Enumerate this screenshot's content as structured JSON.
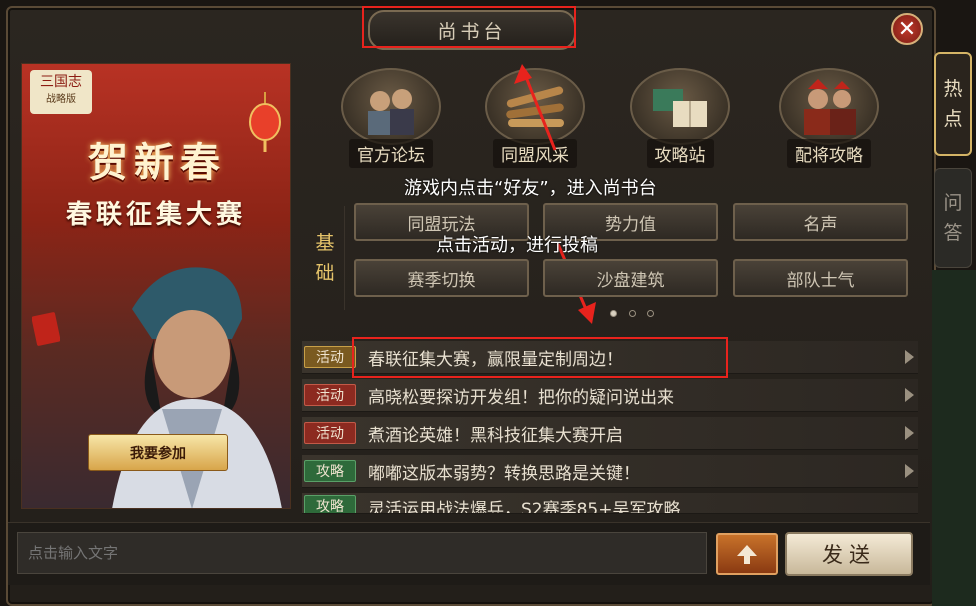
{
  "window": {
    "title": "尚书台",
    "close_glyph": "✕"
  },
  "side_tabs": [
    {
      "label_1": "热",
      "label_2": "点"
    },
    {
      "label_1": "问",
      "label_2": "答"
    }
  ],
  "banner": {
    "logo_line1": "三国志",
    "logo_line2": "战略版",
    "title": "贺新春",
    "subtitle": "春联征集大赛",
    "button": "我要参加"
  },
  "icon_tiles": [
    {
      "label": "官方论坛",
      "icon": "officials-icon"
    },
    {
      "label": "同盟风采",
      "icon": "scrolls-icon"
    },
    {
      "label": "攻略站",
      "icon": "books-icon"
    },
    {
      "label": "配将攻略",
      "icon": "generals-icon"
    }
  ],
  "annotations": {
    "step1": "游戏内点击“好友”，进入尚书台",
    "step2": "点击活动，进行投稿"
  },
  "basic_section": {
    "label_1": "基",
    "label_2": "础",
    "buttons": [
      "同盟玩法",
      "势力值",
      "名声",
      "赛季切换",
      "沙盘建筑",
      "部队士气"
    ]
  },
  "feed": [
    {
      "tag": "活动",
      "text": "春联征集大赛，赢限量定制周边！"
    },
    {
      "tag": "活动",
      "text": "高晓松要探访开发组！把你的疑问说出来"
    },
    {
      "tag": "活动",
      "text": "煮酒论英雄！黑科技征集大赛开启"
    },
    {
      "tag": "攻略",
      "text": "嘟嘟这版本弱势？转换思路是关键！"
    },
    {
      "tag": "攻略",
      "text": "灵活运用战法爆兵，S2赛季85+吴军攻略"
    }
  ],
  "chat": {
    "placeholder": "点击输入文字",
    "send_label": "发送"
  },
  "colors": {
    "highlight": "#e8231d",
    "accent_gold": "#d4b466"
  }
}
